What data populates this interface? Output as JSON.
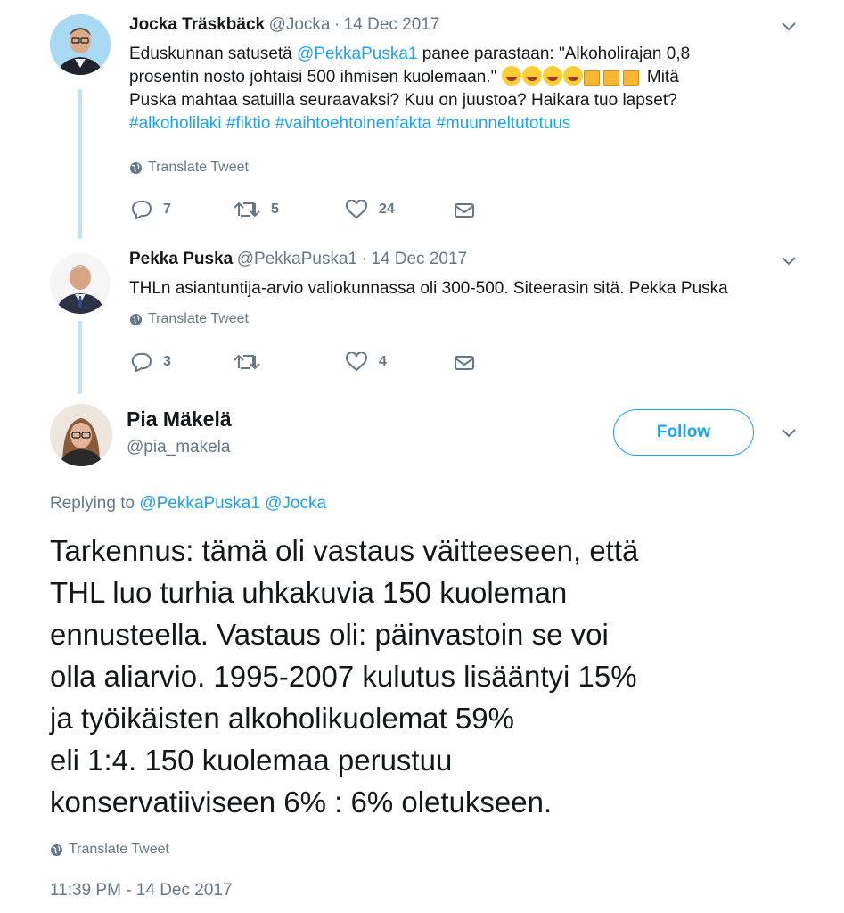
{
  "tweet1": {
    "name": "Jocka Träskbäck",
    "handle": "@Jocka",
    "date": "14 Dec 2017",
    "text_line1_pre": "Eduskunnan satusetä ",
    "text_mention": "@PekkaPuska1",
    "text_line1_post": " panee parastaan: \"Alkoholirajan 0,8",
    "text_line2_pre": "prosentin nosto johtaisi 500 ihmisen kuolemaan.\" ",
    "text_line2_post": " Mitä",
    "text_line3": "Puska mahtaa satuilla seuraavaksi? Kuu on juustoa? Haikara tuo lapset?",
    "hashtags": "#alkoholilaki #fiktio #vaihtoehtoinenfakta #muunneltutotuus",
    "translate": "Translate Tweet",
    "replies": "7",
    "retweets": "5",
    "likes": "24"
  },
  "tweet2": {
    "name": "Pekka Puska",
    "handle": "@PekkaPuska1",
    "date": "14 Dec 2017",
    "text": "THLn asiantuntija-arvio valiokunnassa oli 300-500. Siteerasin sitä. Pekka Puska",
    "translate": "Translate Tweet",
    "replies": "3",
    "likes": "4"
  },
  "main": {
    "name": "Pia Mäkelä",
    "handle": "@pia_makela",
    "follow_label": "Follow",
    "replying_prefix": "Replying to",
    "replying_to_1": "@PekkaPuska1",
    "replying_to_2": "@Jocka",
    "text_lines": [
      "Tarkennus: tämä oli vastaus väitteeseen, että",
      "THL luo turhia uhkakuvia 150 kuoleman",
      "ennusteella. Vastaus oli: päinvastoin se voi",
      "olla aliarvio. 1995-2007 kulutus lisääntyi 15%",
      "ja työikäisten alkoholikuolemat 59%",
      "eli 1:4. 150 kuolemaa perustuu",
      "konservatiiviseen 6% : 6% oletukseen."
    ],
    "translate": "Translate Tweet",
    "timestamp": "11:39 PM - 14 Dec 2017"
  },
  "icons": {
    "reply": "reply-icon",
    "retweet": "retweet-icon",
    "like": "heart-icon",
    "dm": "envelope-icon",
    "globe": "globe-icon",
    "chevron": "chevron-down-icon"
  },
  "colors": {
    "accent": "#1da1f2",
    "muted": "#657786",
    "text": "#14171a",
    "thread_line": "#c4e2f5"
  }
}
